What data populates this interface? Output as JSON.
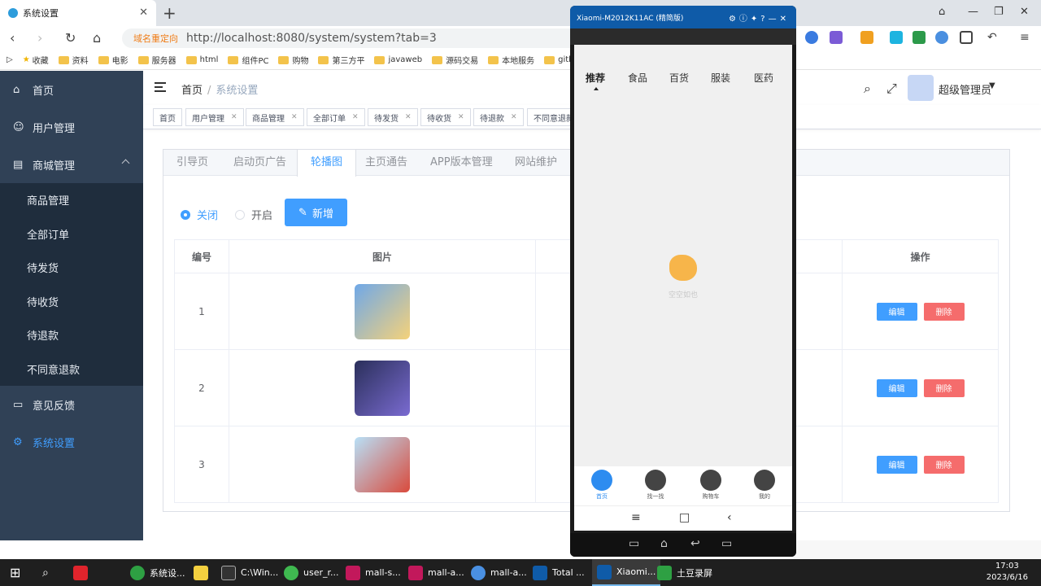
{
  "browser": {
    "tab_title": "系统设置",
    "address_redirect": "域名重定向",
    "address_url": "http://localhost:8080/system/system?tab=3",
    "bookmarks": [
      "收藏",
      "资料",
      "电影",
      "服务器",
      "html",
      "组件PC",
      "购物",
      "第三方平",
      "javaweb",
      "源码交易",
      "本地服务",
      "gith"
    ]
  },
  "sidebar": {
    "items": [
      {
        "label": "首页"
      },
      {
        "label": "用户管理"
      },
      {
        "label": "商城管理"
      }
    ],
    "sub_items": [
      {
        "label": "商品管理"
      },
      {
        "label": "全部订单"
      },
      {
        "label": "待发货"
      },
      {
        "label": "待收货"
      },
      {
        "label": "待退款"
      },
      {
        "label": "不同意退款"
      }
    ],
    "bottom_items": [
      {
        "label": "意见反馈"
      },
      {
        "label": "系统设置"
      }
    ]
  },
  "header": {
    "breadcrumb_home": "首页",
    "breadcrumb_current": "系统设置",
    "username": "超级管理员"
  },
  "tags": [
    {
      "label": "首页"
    },
    {
      "label": "用户管理"
    },
    {
      "label": "商品管理"
    },
    {
      "label": "全部订单"
    },
    {
      "label": "待发货"
    },
    {
      "label": "待收货"
    },
    {
      "label": "待退款"
    },
    {
      "label": "不同意退款"
    }
  ],
  "settings_tabs": [
    "引导页",
    "启动页广告",
    "轮播图",
    "主页通告",
    "APP版本管理",
    "网站维护"
  ],
  "active_tab": "轮播图",
  "carousel": {
    "radio_off": "关闭",
    "radio_on": "开启",
    "add_button": "新增",
    "columns": [
      "编号",
      "图片",
      "",
      "操作"
    ],
    "rows": [
      {
        "id": "1",
        "image_colors": [
          "#6fa8e8",
          "#f5d27a"
        ]
      },
      {
        "id": "2",
        "image_colors": [
          "#2a2f5a",
          "#7a6bd1"
        ]
      },
      {
        "id": "3",
        "image_colors": [
          "#b8e0f7",
          "#d94a3c"
        ]
      }
    ],
    "edit_label": "编辑",
    "delete_label": "删除"
  },
  "phone": {
    "window_title": "Xiaomi-M2012K11AC (精简版)",
    "top_tabs": [
      "推荐",
      "食品",
      "百货",
      "服装",
      "医药"
    ],
    "empty_text": "空空如也",
    "bottom_nav": [
      "首页",
      "找一找",
      "购物车",
      "我的"
    ]
  },
  "taskbar": {
    "apps": [
      "系统设...",
      "C:\\Win...",
      "user_r...",
      "mall-s...",
      "mall-a...",
      "mall-a...",
      "Total ...",
      "Xiaomi...",
      "土豆录屏"
    ],
    "time": "17:03",
    "date": "2023/6/16"
  },
  "colors": {
    "sidebar_bg": "#304156",
    "accent": "#409eff",
    "danger": "#f56c6c"
  }
}
